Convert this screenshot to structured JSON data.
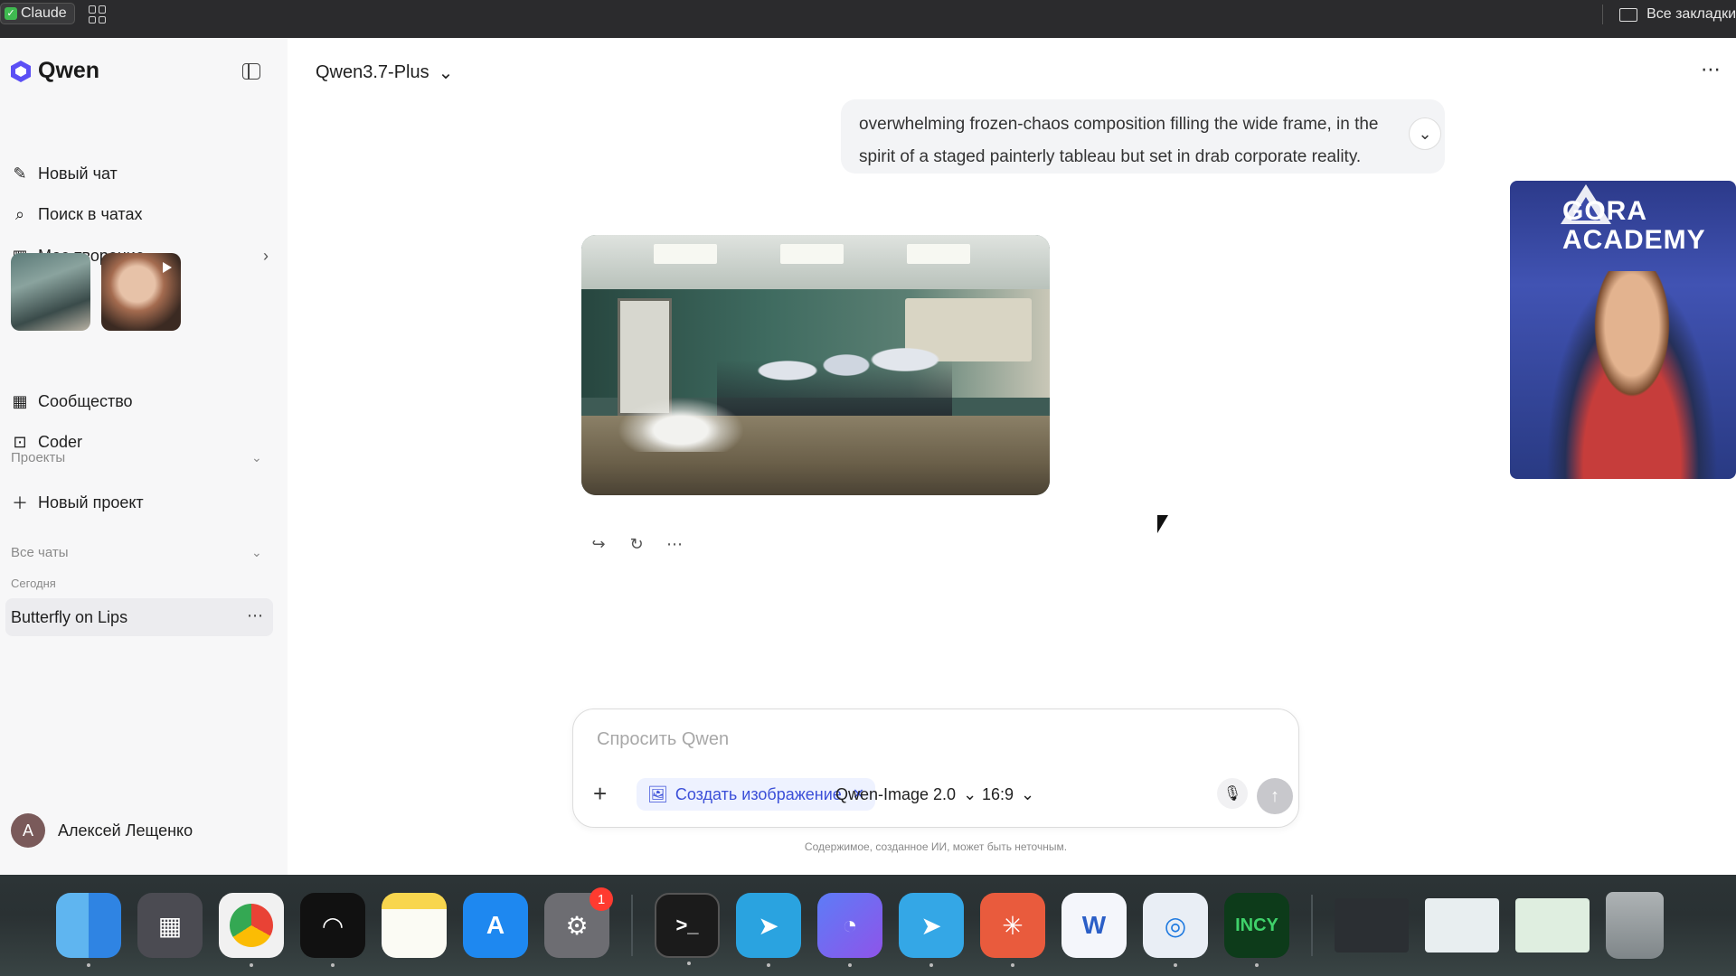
{
  "browser": {
    "profile_tag": "Claude",
    "bookmarks_label": "Все закладки"
  },
  "sidebar": {
    "logo_text": "Qwen",
    "items": [
      {
        "label": "Новый чат",
        "icon": "new-chat-icon"
      },
      {
        "label": "Поиск в чатах",
        "icon": "search-icon"
      },
      {
        "label": "Мое творение",
        "icon": "library-icon"
      },
      {
        "label": "Сообщество",
        "icon": "grid-icon"
      },
      {
        "label": "Coder",
        "icon": "terminal-icon"
      }
    ],
    "projects_label": "Проекты",
    "new_project_label": "Новый проект",
    "all_chats_label": "Все чаты",
    "today_label": "Сегодня",
    "chat_title": "Butterfly on Lips",
    "user_initial": "А",
    "user_name": "Алексей Лещенко"
  },
  "main": {
    "model_name": "Qwen3.7-Plus",
    "message_lines": [
      "overwhelming frozen-chaos composition filling the wide frame, in the",
      "spirit of a staged painterly tableau but set in drab corporate reality."
    ],
    "composer": {
      "placeholder": "Спросить Qwen",
      "chip_label": "Создать изображение",
      "image_model": "Qwen-Image 2.0",
      "aspect_ratio": "16:9"
    },
    "disclaimer": "Содержимое, созданное ИИ, может быть неточным."
  },
  "webcam": {
    "brand": "GORA ACADEMY"
  },
  "dock": {
    "settings_badge": "1",
    "incy_label": "INCY"
  },
  "colors": {
    "accent": "#3b4fd8",
    "sidebar_bg": "#f7f7f8",
    "chat_selected_bg": "#ececef"
  }
}
